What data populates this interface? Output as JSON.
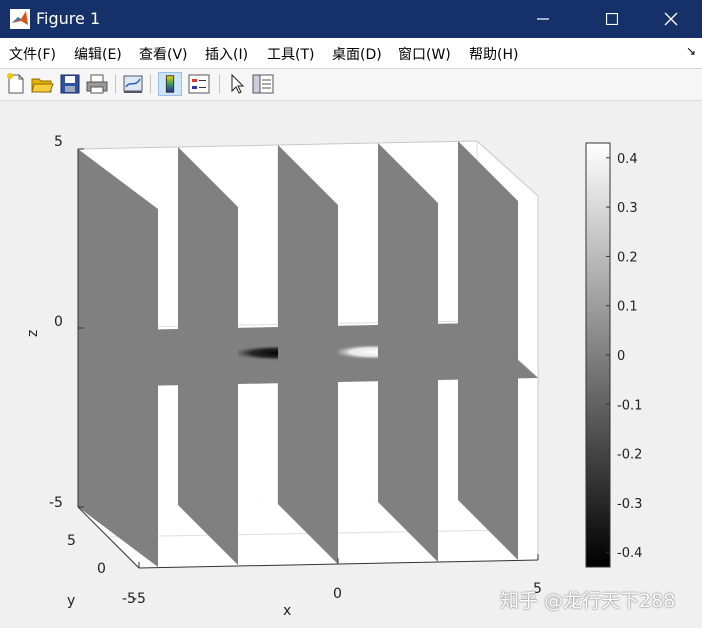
{
  "window": {
    "title": "Figure 1"
  },
  "menu": {
    "items": [
      "文件(F)",
      "编辑(E)",
      "查看(V)",
      "插入(I)",
      "工具(T)",
      "桌面(D)",
      "窗口(W)",
      "帮助(H)"
    ]
  },
  "toolbar": {
    "icons": [
      "new-figure-icon",
      "open-file-icon",
      "save-icon",
      "print-icon",
      "link-plot-icon",
      "colorbar-icon",
      "legend-icon",
      "pointer-icon",
      "property-editor-icon"
    ]
  },
  "chart_data": {
    "type": "heatmap",
    "description_kind": "3d slice plot",
    "xlabel": "x",
    "ylabel": "y",
    "zlabel": "z",
    "xlim": [
      -5,
      5
    ],
    "ylim": [
      -5,
      5
    ],
    "zlim": [
      -5,
      5
    ],
    "x_ticks": [
      "-5",
      "0",
      "5"
    ],
    "y_ticks": [
      "-5",
      "0",
      "5"
    ],
    "z_ticks": [
      "5",
      "0",
      "-5"
    ],
    "x_slices": [
      -4,
      -2,
      0,
      2,
      4
    ],
    "z_slices": [
      0
    ],
    "colormap": "gray",
    "colorbar": {
      "ticks": [
        "0.4",
        "0.3",
        "0.2",
        "0.1",
        "0",
        "-0.1",
        "-0.2",
        "-0.3",
        "-0.4"
      ],
      "min": -0.43,
      "max": 0.43
    }
  },
  "watermark": "知乎 @龙行天下288",
  "colors": {
    "titlebar": "#16316a",
    "plane": "#808080",
    "background": "#f0f0f0"
  }
}
